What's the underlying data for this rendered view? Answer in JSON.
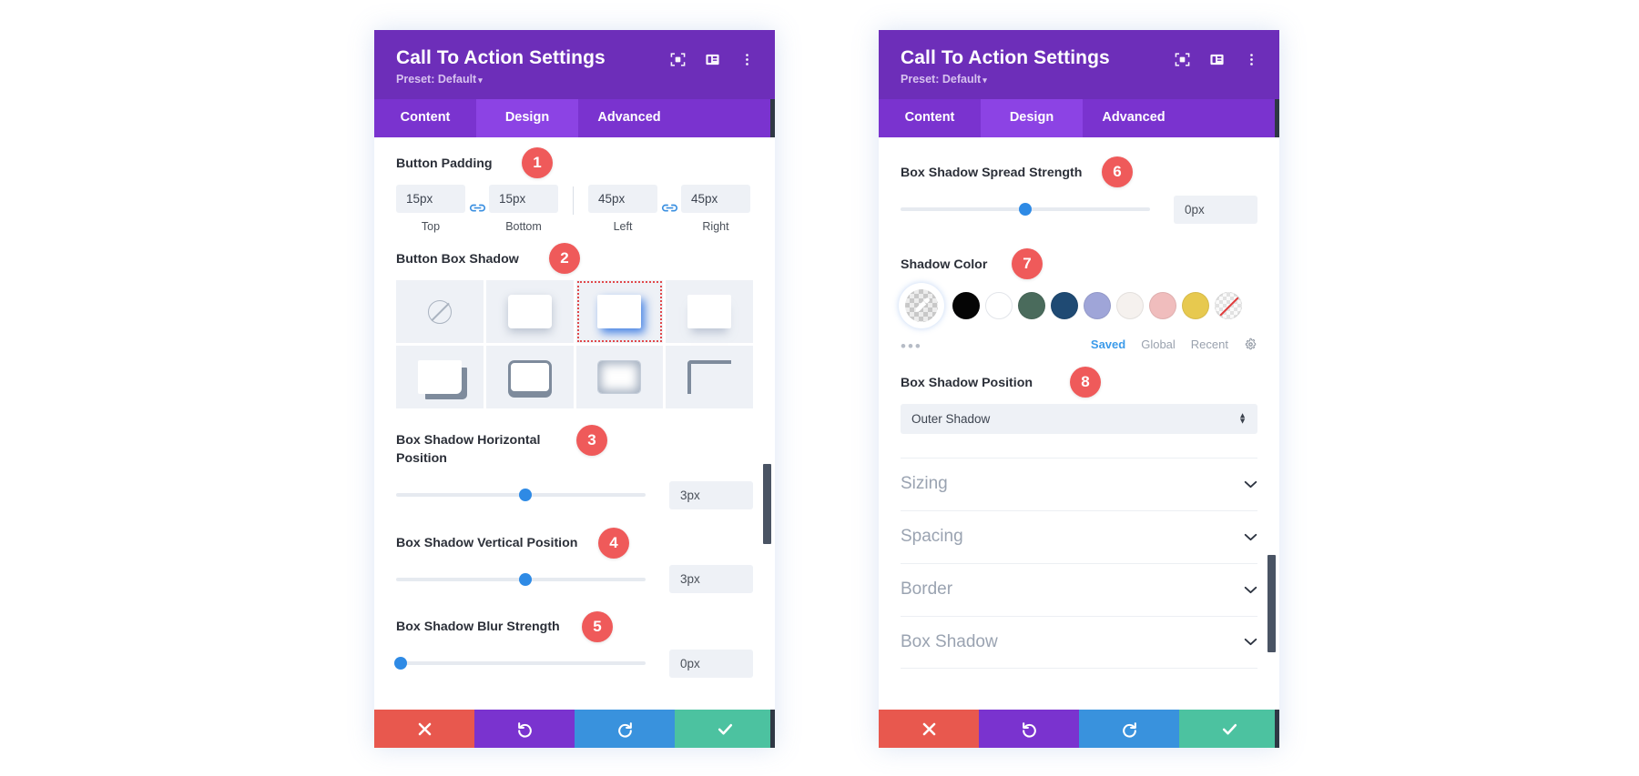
{
  "panels": {
    "left": {
      "header": {
        "title": "Call To Action Settings",
        "preset": "Preset: Default",
        "caret": "▾",
        "icons": [
          "focus-icon",
          "layout-icon",
          "more-vertical-icon"
        ]
      },
      "tabs": [
        {
          "label": "Content",
          "active": false
        },
        {
          "label": "Design",
          "active": true
        },
        {
          "label": "Advanced",
          "active": false
        }
      ],
      "button_padding": {
        "label": "Button Padding",
        "badge": "1",
        "fields": [
          {
            "value": "15px",
            "caption": "Top"
          },
          {
            "value": "15px",
            "caption": "Bottom"
          },
          {
            "value": "45px",
            "caption": "Left"
          },
          {
            "value": "45px",
            "caption": "Right"
          }
        ],
        "link_icon": "link-icon"
      },
      "button_box_shadow": {
        "label": "Button Box Shadow",
        "badge": "2",
        "presets": [
          {
            "name": "none",
            "selected": false
          },
          {
            "name": "soft-drop",
            "selected": false
          },
          {
            "name": "offset-blue",
            "selected": true
          },
          {
            "name": "bottom-fade",
            "selected": false
          },
          {
            "name": "hard-corner",
            "selected": false
          },
          {
            "name": "outline-bottom",
            "selected": false
          },
          {
            "name": "inner-glow",
            "selected": false
          },
          {
            "name": "top-left-frame",
            "selected": false
          }
        ]
      },
      "horizontal_position": {
        "label": "Box Shadow Horizontal Position",
        "badge": "3",
        "value": "3px",
        "knob_percent": 52
      },
      "vertical_position": {
        "label": "Box Shadow Vertical Position",
        "badge": "4",
        "value": "3px",
        "knob_percent": 52
      },
      "blur_strength": {
        "label": "Box Shadow Blur Strength",
        "badge": "5",
        "value": "0px",
        "knob_percent": 2
      },
      "scrollbar": {
        "top_percent": 57,
        "height_percent": 14
      },
      "footer": [
        {
          "name": "cancel-button",
          "icon": "close-icon",
          "color": "#e8584e"
        },
        {
          "name": "undo-button",
          "icon": "undo-icon",
          "color": "#7a33cf"
        },
        {
          "name": "redo-button",
          "icon": "redo-icon",
          "color": "#3992dd"
        },
        {
          "name": "save-button",
          "icon": "check-icon",
          "color": "#4cc2a0"
        }
      ]
    },
    "right": {
      "header": {
        "title": "Call To Action Settings",
        "preset": "Preset: Default",
        "caret": "▾",
        "icons": [
          "focus-icon",
          "layout-icon",
          "more-vertical-icon"
        ]
      },
      "tabs": [
        {
          "label": "Content",
          "active": false
        },
        {
          "label": "Design",
          "active": true
        },
        {
          "label": "Advanced",
          "active": false
        }
      ],
      "spread_strength": {
        "label": "Box Shadow Spread Strength",
        "badge": "6",
        "value": "0px",
        "knob_percent": 50
      },
      "shadow_color": {
        "label": "Shadow Color",
        "badge": "7",
        "picker_icon": "eyedropper-icon",
        "swatches": [
          {
            "name": "swatch-black",
            "color": "#050505"
          },
          {
            "name": "swatch-white",
            "color": "#ffffff"
          },
          {
            "name": "swatch-green",
            "color": "#4a6b5c"
          },
          {
            "name": "swatch-navy",
            "color": "#1f4a73"
          },
          {
            "name": "swatch-periwinkle",
            "color": "#9fa5d8"
          },
          {
            "name": "swatch-offwhite",
            "color": "#f5f1ee"
          },
          {
            "name": "swatch-pink",
            "color": "#f0bdbd"
          },
          {
            "name": "swatch-gold",
            "color": "#e7c94f"
          },
          {
            "name": "swatch-transparent",
            "color": "none"
          }
        ],
        "more": "•••",
        "tabs": [
          {
            "label": "Saved",
            "active": true
          },
          {
            "label": "Global",
            "active": false
          },
          {
            "label": "Recent",
            "active": false
          }
        ],
        "settings_icon": "gear-icon"
      },
      "shadow_position": {
        "label": "Box Shadow Position",
        "badge": "8",
        "value": "Outer Shadow"
      },
      "accordion": [
        {
          "label": "Sizing"
        },
        {
          "label": "Spacing"
        },
        {
          "label": "Border"
        },
        {
          "label": "Box Shadow"
        }
      ],
      "scrollbar": {
        "top_percent": 73,
        "height_percent": 17
      },
      "footer": [
        {
          "name": "cancel-button",
          "icon": "close-icon",
          "color": "#e8584e"
        },
        {
          "name": "undo-button",
          "icon": "undo-icon",
          "color": "#7a33cf"
        },
        {
          "name": "redo-button",
          "icon": "redo-icon",
          "color": "#3992dd"
        },
        {
          "name": "save-button",
          "icon": "check-icon",
          "color": "#4cc2a0"
        }
      ]
    }
  },
  "colors": {
    "header_purple": "#6d2eb9",
    "tab_purple": "#7a33cf",
    "tab_active": "#8c43e4",
    "badge_red": "#ef5a5a",
    "slider_blue": "#2e8ae5",
    "input_bg": "#eef1f6"
  }
}
